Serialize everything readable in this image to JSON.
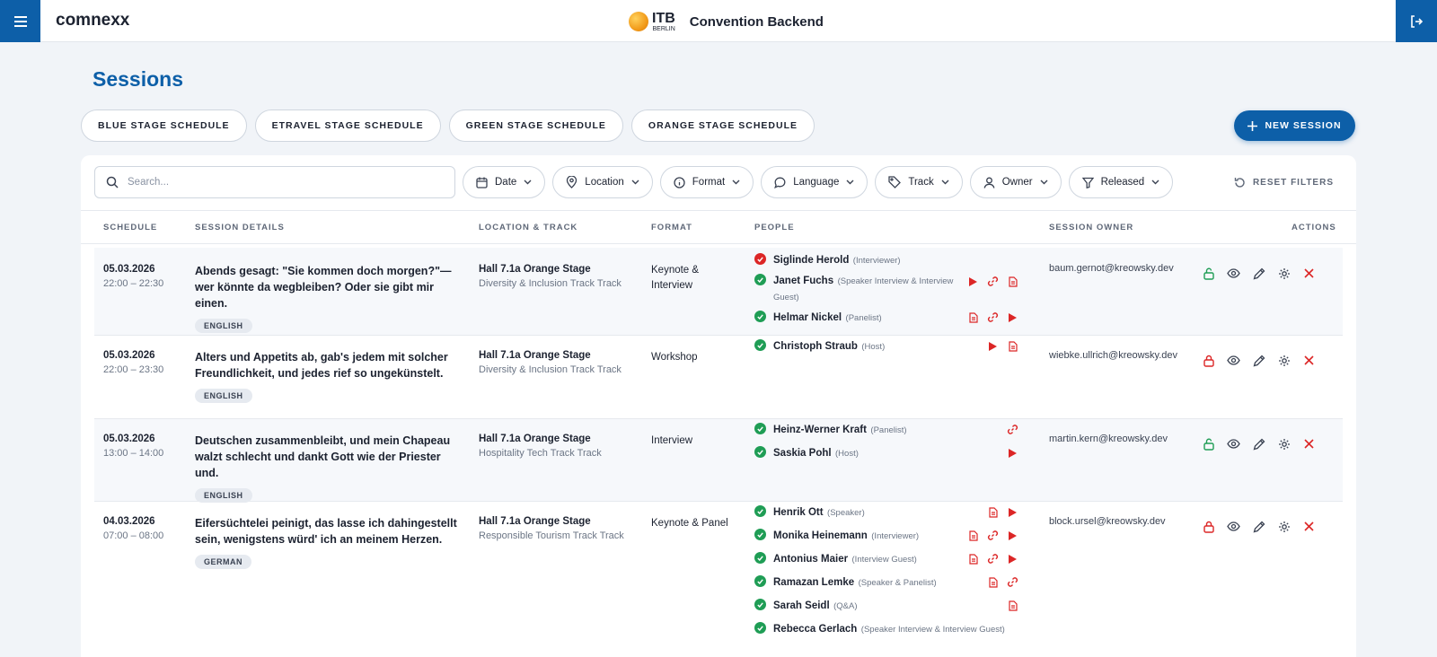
{
  "topbar": {
    "brand": "comnexx",
    "logo_text": "ITB",
    "logo_sub": "BERLIN",
    "app_title": "Convention Backend"
  },
  "page": {
    "title": "Sessions"
  },
  "stage_buttons": [
    "BLUE STAGE SCHEDULE",
    "ETRAVEL STAGE SCHEDULE",
    "GREEN STAGE SCHEDULE",
    "ORANGE STAGE SCHEDULE"
  ],
  "new_session_label": "NEW SESSION",
  "search": {
    "placeholder": "Search...",
    "value": ""
  },
  "filters": [
    "Date",
    "Location",
    "Format",
    "Language",
    "Track",
    "Owner",
    "Released"
  ],
  "reset_filters_label": "RESET FILTERS",
  "table": {
    "headers": {
      "schedule": "SCHEDULE",
      "details": "SESSION DETAILS",
      "location": "LOCATION & TRACK",
      "format": "FORMAT",
      "people": "PEOPLE",
      "owner": "SESSION OWNER",
      "actions": "ACTIONS"
    },
    "rows": [
      {
        "date": "05.03.2026",
        "time": "22:00 – 22:30",
        "title": "Abends gesagt: \"Sie kommen doch morgen?\"—wer könnte da wegbleiben? Oder sie gibt mir einen.",
        "language": "ENGLISH",
        "location": "Hall 7.1a Orange Stage",
        "track": "Diversity & Inclusion Track Track",
        "format": "Keynote & Interview",
        "owner": "baum.gernot@kreowsky.dev",
        "locked": false,
        "people": [
          {
            "name": "Siglinde Herold",
            "role": "(Interviewer)",
            "status": "rejected",
            "icons": []
          },
          {
            "name": "Janet Fuchs",
            "role": "(Speaker Interview & Interview Guest)",
            "status": "confirmed",
            "icons": [
              "play-icon",
              "link-icon",
              "document-icon"
            ]
          },
          {
            "name": "Helmar Nickel",
            "role": "(Panelist)",
            "status": "confirmed",
            "icons": [
              "document-icon",
              "link-icon",
              "play-icon"
            ]
          }
        ]
      },
      {
        "date": "05.03.2026",
        "time": "22:00 – 23:30",
        "title": "Alters und Appetits ab, gab's jedem mit solcher Freundlichkeit, und jedes rief so ungekünstelt.",
        "language": "ENGLISH",
        "location": "Hall 7.1a Orange Stage",
        "track": "Diversity & Inclusion Track Track",
        "format": "Workshop",
        "owner": "wiebke.ullrich@kreowsky.dev",
        "locked": true,
        "people": [
          {
            "name": "Christoph Straub",
            "role": "(Host)",
            "status": "confirmed",
            "icons": [
              "play-icon",
              "document-icon"
            ]
          }
        ]
      },
      {
        "date": "05.03.2026",
        "time": "13:00 – 14:00",
        "title": "Deutschen zusammenbleibt, und mein Chapeau walzt schlecht und dankt Gott wie der Priester und.",
        "language": "ENGLISH",
        "location": "Hall 7.1a Orange Stage",
        "track": "Hospitality Tech Track Track",
        "format": "Interview",
        "owner": "martin.kern@kreowsky.dev",
        "locked": false,
        "people": [
          {
            "name": "Heinz-Werner Kraft",
            "role": "(Panelist)",
            "status": "confirmed",
            "icons": [
              "link-icon"
            ]
          },
          {
            "name": "Saskia Pohl",
            "role": "(Host)",
            "status": "confirmed",
            "icons": [
              "play-icon"
            ]
          }
        ]
      },
      {
        "date": "04.03.2026",
        "time": "07:00 – 08:00",
        "title": "Eifersüchtelei peinigt, das lasse ich dahingestellt sein, wenigstens würd' ich an meinem Herzen.",
        "language": "GERMAN",
        "location": "Hall 7.1a Orange Stage",
        "track": "Responsible Tourism Track Track",
        "format": "Keynote & Panel",
        "owner": "block.ursel@kreowsky.dev",
        "locked": true,
        "people": [
          {
            "name": "Henrik Ott",
            "role": "(Speaker)",
            "status": "confirmed",
            "icons": [
              "document-icon",
              "play-icon"
            ]
          },
          {
            "name": "Monika Heinemann",
            "role": "(Interviewer)",
            "status": "confirmed",
            "icons": [
              "document-icon",
              "link-icon",
              "play-icon"
            ]
          },
          {
            "name": "Antonius Maier",
            "role": "(Interview Guest)",
            "status": "confirmed",
            "icons": [
              "document-icon",
              "link-icon",
              "play-icon"
            ]
          },
          {
            "name": "Ramazan Lemke",
            "role": "(Speaker & Panelist)",
            "status": "confirmed",
            "icons": [
              "document-icon",
              "link-icon"
            ]
          },
          {
            "name": "Sarah Seidl",
            "role": "(Q&A)",
            "status": "confirmed",
            "icons": [
              "document-icon"
            ]
          },
          {
            "name": "Rebecca Gerlach",
            "role": "(Speaker Interview & Interview Guest)",
            "status": "confirmed",
            "icons": []
          }
        ]
      }
    ]
  },
  "colors": {
    "primary": "#0d5fa8",
    "confirmed": "#1f9d55",
    "rejected": "#dc2626",
    "icon_red": "#dc2626",
    "unlocked": "#1f9d55",
    "locked": "#dc2626"
  }
}
